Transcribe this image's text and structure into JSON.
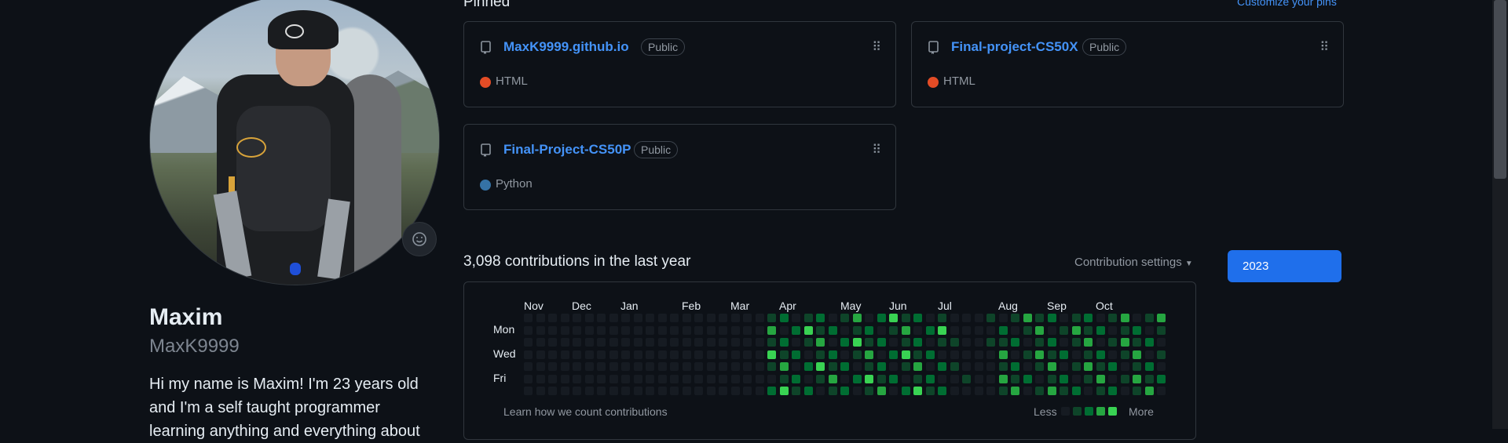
{
  "profile": {
    "name": "Maxim",
    "login": "MaxK9999",
    "bio": "Hi my name is Maxim! I'm 23 years old and I'm a self taught programmer learning anything and everything about"
  },
  "pinned": {
    "title": "Pinned",
    "customize": "Customize your pins",
    "repos": [
      {
        "name": "MaxK9999.github.io",
        "visibility": "Public",
        "language": "HTML",
        "lang_color": "#e34c26"
      },
      {
        "name": "Final-project-CS50X",
        "visibility": "Public",
        "language": "HTML",
        "lang_color": "#e34c26"
      },
      {
        "name": "Final-Project-CS50P",
        "visibility": "Public",
        "language": "Python",
        "lang_color": "#3572a5"
      }
    ]
  },
  "contributions": {
    "title": "3,098 contributions in the last year",
    "settings": "Contribution settings",
    "year": "2023",
    "months": [
      "Nov",
      "Dec",
      "Jan",
      "Feb",
      "Mar",
      "Apr",
      "May",
      "Jun",
      "Jul",
      "Aug",
      "Sep",
      "Oct"
    ],
    "days": [
      "Mon",
      "Wed",
      "Fri"
    ],
    "learn": "Learn how we count contributions",
    "less": "Less",
    "more": "More",
    "palette": [
      "#161b22",
      "#0e4429",
      "#006d32",
      "#26a641",
      "#39d353"
    ]
  },
  "icons": {
    "repo": "repo-icon",
    "kebab": "kebab-vertical-icon",
    "emoji": "smiley-icon",
    "caret": "triangle-down-icon"
  }
}
